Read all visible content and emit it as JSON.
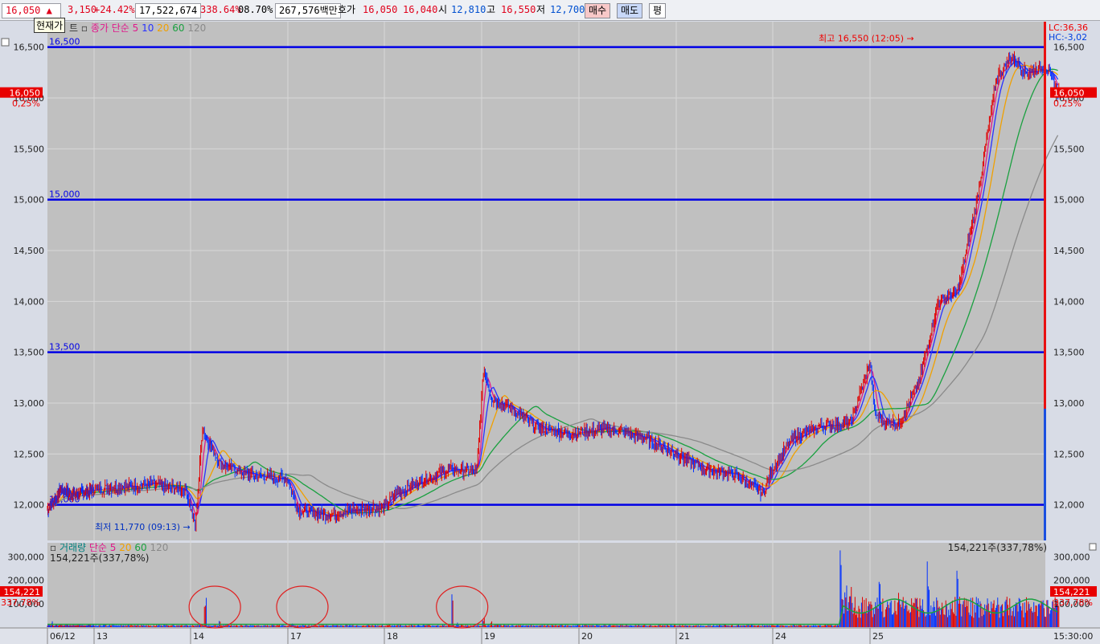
{
  "topbar": {
    "price": "16,050",
    "up_arrow": "▲",
    "change": "3,150",
    "change_pct": "+24.42%",
    "volume": "17,522,674",
    "volume_ratio": "338.64%",
    "turnover": "08.70%",
    "amount": "267,576백만",
    "quote_label": "호가",
    "ask": "16,050",
    "bid": "16,040",
    "open_label": "시",
    "open": "12,810",
    "high_label": "고",
    "high": "16,550",
    "low_label": "저",
    "low": "12,700",
    "buy_btn": "매수",
    "sell_btn": "매도",
    "eval_btn": "평",
    "tooltip": "현재가"
  },
  "legend": {
    "price_prefix": "트",
    "price_label": "종가 단순",
    "ma": [
      "5",
      "10",
      "20",
      "60",
      "120"
    ],
    "volume_label": "거래량 단순",
    "volume_current": "154,221주(337,78%)"
  },
  "colors": {
    "ma5": "#e0198c",
    "ma10": "#2832ff",
    "ma20": "#f0a000",
    "ma60": "#1aa040",
    "ma120": "#8a8a8a",
    "hline": "#0000e6",
    "up": "#e00000",
    "down": "#0030ff",
    "plot_bg": "#c0c0c0"
  },
  "chart_data": [
    {
      "type": "line",
      "title": "",
      "x_ticks": [
        "06/12",
        "13",
        "14",
        "17",
        "18",
        "19",
        "20",
        "21",
        "24",
        "25"
      ],
      "y_ticks": [
        "16,500",
        "16,000",
        "15,500",
        "15,000",
        "14,500",
        "14,000",
        "13,500",
        "13,000",
        "12,500",
        "12,000"
      ],
      "ylim": [
        11650,
        16750
      ],
      "horizontal_lines": [
        {
          "value": 16500,
          "label": "16,500"
        },
        {
          "value": 15000,
          "label": "15,000"
        },
        {
          "value": 13500,
          "label": "13,500"
        },
        {
          "value": 12000,
          "label": "12,000"
        }
      ],
      "series": [
        {
          "name": "종가",
          "x": [
            0,
            0.3,
            0.6,
            1,
            1.3,
            1.6,
            1.95,
            2.05,
            2.12,
            2.3,
            2.6,
            3,
            3.1,
            3.4,
            3.7,
            4,
            4.1,
            4.4,
            4.7,
            4.95,
            5.02,
            5.1,
            5.3,
            5.6,
            5.9,
            6.3,
            6.7,
            7,
            7.3,
            7.6,
            7.9,
            8,
            8.2,
            8.5,
            8.7,
            8.8,
            9,
            9.05,
            9.15,
            9.3,
            9.5,
            9.7,
            9.9,
            10.1,
            10.3,
            10.45,
            10.6,
            10.8,
            10.95
          ],
          "values": [
            11950,
            12150,
            12100,
            12150,
            12180,
            12200,
            12150,
            11790,
            12750,
            12400,
            12300,
            12250,
            11950,
            11900,
            11950,
            11980,
            12100,
            12250,
            12350,
            12330,
            13350,
            13050,
            12950,
            12750,
            12700,
            12750,
            12650,
            12500,
            12350,
            12300,
            12120,
            12350,
            12650,
            12780,
            12790,
            12800,
            13400,
            12900,
            12820,
            12800,
            13200,
            14000,
            14100,
            15000,
            16200,
            16400,
            16250,
            16300,
            16050
          ]
        }
      ],
      "annotations": [
        {
          "text": "최고 16,550 (12:05)",
          "value": 16550
        },
        {
          "text": "최저 11,770 (09:13)",
          "value": 11770
        }
      ],
      "right_badges": {
        "price": "16,050",
        "pct": "0,25%",
        "lc": "LC:36,36",
        "hc": "HC:-3,02"
      }
    },
    {
      "type": "bar",
      "title": "",
      "x_ticks": [
        "06/12",
        "13",
        "14",
        "17",
        "18",
        "19",
        "20",
        "21",
        "24",
        "25"
      ],
      "y_ticks": [
        "300,000",
        "200,000",
        "100,000"
      ],
      "ylim": [
        0,
        360000
      ],
      "series": [
        {
          "name": "거래량",
          "x": [
            0.1,
            0.5,
            1.0,
            1.5,
            2.1,
            2.15,
            2.3,
            3.05,
            3.5,
            4.05,
            4.5,
            4.7,
            4.75,
            5.02,
            5.1,
            5.5,
            6.0,
            6.5,
            7.0,
            7.5,
            8.0,
            8.5,
            8.7,
            8.75,
            8.8,
            9.0,
            9.1,
            9.3,
            9.6,
            9.7,
            9.9,
            10.1,
            10.3,
            10.5,
            10.7,
            10.9
          ],
          "values": [
            25000,
            8000,
            10000,
            6000,
            12000,
            140000,
            30000,
            20000,
            8000,
            15000,
            8000,
            150000,
            20000,
            40000,
            25000,
            8000,
            10000,
            7000,
            6000,
            12000,
            10000,
            8000,
            350000,
            220000,
            180000,
            120000,
            280000,
            200000,
            300000,
            150000,
            250000,
            200000,
            100000,
            120000,
            80000,
            154221
          ]
        }
      ],
      "right_badges": {
        "value": "154,221",
        "pct": "337,78%"
      }
    }
  ],
  "time_label": "15:30:00"
}
